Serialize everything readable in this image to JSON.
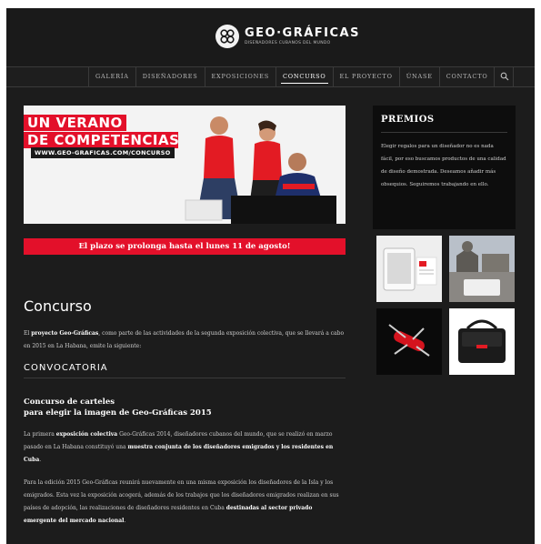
{
  "brand": {
    "title": "GEO·GRÁFICAS",
    "subtitle": "DISEÑADORES CUBANOS DEL MUNDO"
  },
  "nav": {
    "items": [
      "GALERÍA",
      "DISEÑADORES",
      "EXPOSICIONES",
      "CONCURSO",
      "EL PROYECTO",
      "ÚNASE",
      "CONTACTO"
    ],
    "active": "CONCURSO"
  },
  "banner": {
    "line1": "UN VERANO",
    "line2": "DE COMPETENCIAS",
    "url": "WWW.GEO-GRAFICAS.COM/CONCURSO"
  },
  "deadline": "El plazo se prolonga hasta el lunes 11 de agosto!",
  "premios": {
    "title": "PREMIOS",
    "text": "Elegir regalos para un diseñador no es nada fácil, por eso buscamos productos de una calidad de diseño demostrada. Deseamos añadir más obsequios. Seguiremos trabajando en ello."
  },
  "article": {
    "title": "Concurso",
    "intro_pre": "El ",
    "intro_bold": "proyecto Geo-Gráficas",
    "intro_post": ", como parte de las actividades de la segunda exposición colectiva, que se llevará a cabo en 2015 en La Habana, emite la siguiente:",
    "section": "CONVOCATORIA",
    "subhead_1": "Concurso de carteles",
    "subhead_2": "para elegir la imagen de Geo-Gráficas 2015",
    "p1_a": "La primera ",
    "p1_b": "exposición colectiva",
    "p1_c": " Geo-Gráficas 2014, diseñadores cubanos del mundo, que se realizó en marzo pasado en La Habana constituyó una ",
    "p1_d": "muestra conjunta de los diseñadores emigrados y los residentes en Cuba",
    "p1_e": ".",
    "p2_a": "Para la edición 2015 Geo-Gráficas reunirá nuevamente en una misma exposición los diseñadores de la Isla y los emigrados. Esta vez la exposición acogerá, además de los trabajos que los diseñadores emigrados realizan en sus países de adopción, las realizaciones de diseñadores residentes en Cuba ",
    "p2_b": "destinadas al sector privado emergente del mercado nacional",
    "p2_c": "."
  }
}
